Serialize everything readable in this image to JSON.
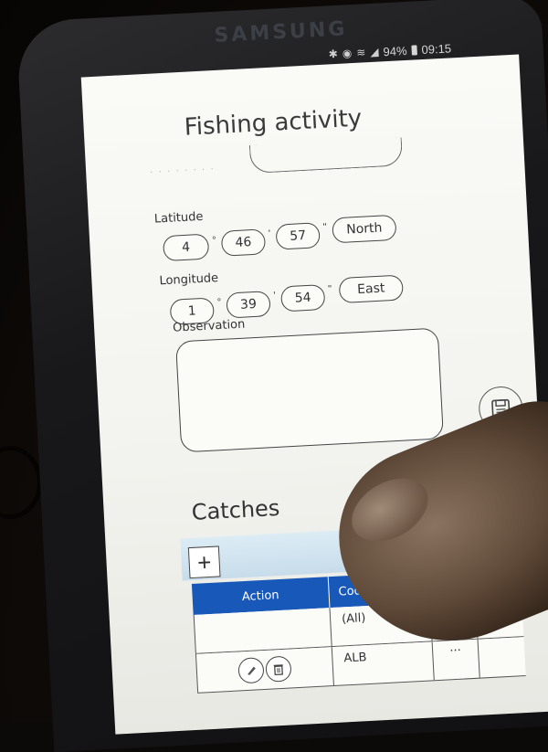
{
  "device": {
    "brand": "SAMSUNG",
    "status": {
      "battery": "94%",
      "time": "09:15"
    }
  },
  "form": {
    "title": "Fishing activity",
    "latitude": {
      "label": "Latitude",
      "degrees": "4",
      "minutes": "46",
      "seconds": "57",
      "hemisphere": "North"
    },
    "longitude": {
      "label": "Longitude",
      "degrees": "1",
      "minutes": "39",
      "seconds": "54",
      "hemisphere": "East"
    },
    "observation": {
      "label": "Observation",
      "value": ""
    },
    "symbols": {
      "degree": "°",
      "minute": "'",
      "second": "\""
    }
  },
  "catches": {
    "title": "Catches",
    "add_label": "+",
    "columns": [
      "Action",
      "Code"
    ],
    "rows": [
      {
        "code": "(All)"
      },
      {
        "code": "ALB",
        "more": "···"
      }
    ]
  },
  "icons": [
    "bluetooth-icon",
    "alarm-icon",
    "wifi-icon",
    "signal-icon",
    "battery-icon",
    "save-icon",
    "edit-icon",
    "delete-icon"
  ]
}
